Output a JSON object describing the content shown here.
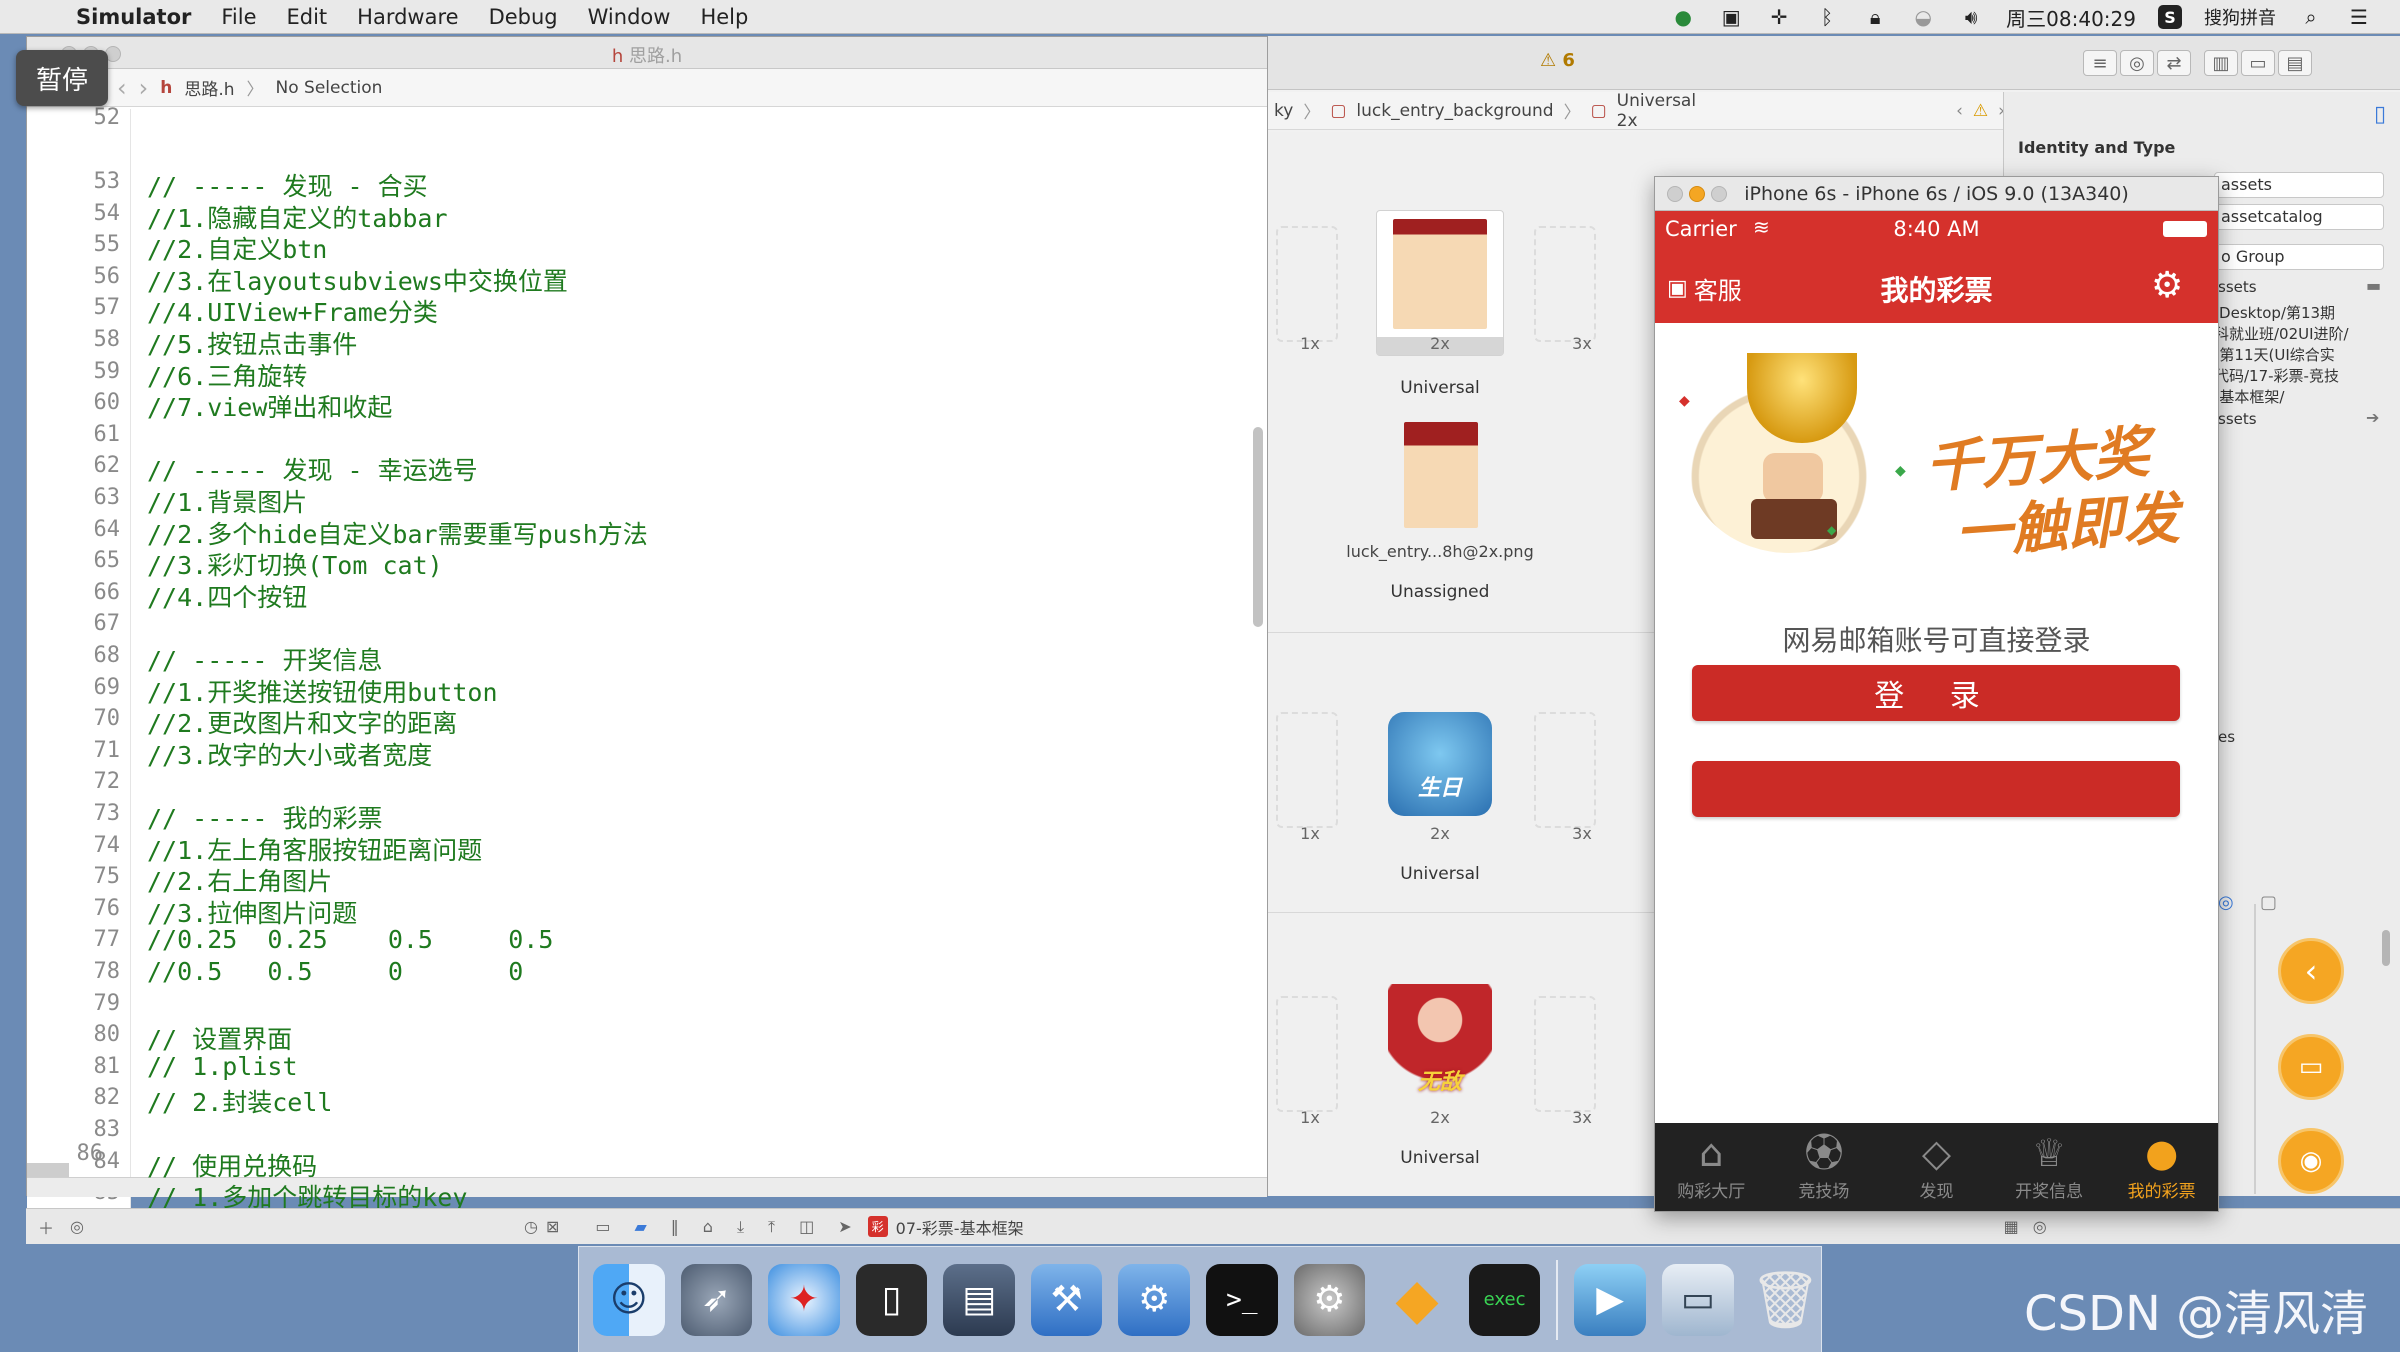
{
  "menubar": {
    "app_name": "Simulator",
    "menus": [
      "File",
      "Edit",
      "Hardware",
      "Debug",
      "Window",
      "Help"
    ],
    "clock": "周三08:40:29",
    "input_method": "搜狗拼音"
  },
  "pause_badge": "暂停",
  "editor": {
    "title": "思路.h",
    "jumpbar_file": "思路.h",
    "jumpbar_selection": "No Selection",
    "first_line_number": "52",
    "lines": [
      {
        "n": "53",
        "text": "// ----- 发现 - 合买"
      },
      {
        "n": "54",
        "text": "//1.隐藏自定义的tabbar"
      },
      {
        "n": "55",
        "text": "//2.自定义btn"
      },
      {
        "n": "56",
        "text": "//3.在layoutsubviews中交换位置"
      },
      {
        "n": "57",
        "text": "//4.UIView+Frame分类"
      },
      {
        "n": "58",
        "text": "//5.按钮点击事件"
      },
      {
        "n": "59",
        "text": "//6.三角旋转"
      },
      {
        "n": "60",
        "text": "//7.view弹出和收起"
      },
      {
        "n": "61",
        "text": ""
      },
      {
        "n": "62",
        "text": "// ----- 发现 - 幸运选号"
      },
      {
        "n": "63",
        "text": "//1.背景图片"
      },
      {
        "n": "64",
        "text": "//2.多个hide自定义bar需要重写push方法"
      },
      {
        "n": "65",
        "text": "//3.彩灯切换(Tom cat)"
      },
      {
        "n": "66",
        "text": "//4.四个按钮"
      },
      {
        "n": "67",
        "text": ""
      },
      {
        "n": "68",
        "text": "// ----- 开奖信息"
      },
      {
        "n": "69",
        "text": "//1.开奖推送按钮使用button"
      },
      {
        "n": "70",
        "text": "//2.更改图片和文字的距离"
      },
      {
        "n": "71",
        "text": "//3.改字的大小或者宽度"
      },
      {
        "n": "72",
        "text": ""
      },
      {
        "n": "73",
        "text": "// ----- 我的彩票"
      },
      {
        "n": "74",
        "text": "//1.左上角客服按钮距离问题"
      },
      {
        "n": "75",
        "text": "//2.右上角图片"
      },
      {
        "n": "76",
        "text": "//3.拉伸图片问题"
      },
      {
        "n": "77",
        "text": "//0.25  0.25    0.5     0.5"
      },
      {
        "n": "78",
        "text": "//0.5   0.5     0       0"
      },
      {
        "n": "79",
        "text": ""
      },
      {
        "n": "80",
        "text": "// 设置界面"
      },
      {
        "n": "81",
        "text": "// 1.plist"
      },
      {
        "n": "82",
        "text": "// 2.封装cell"
      },
      {
        "n": "83",
        "text": ""
      },
      {
        "n": "84",
        "text": "// 使用兑换码"
      },
      {
        "n": "85",
        "text": "// 1.多加个跳转目标的key"
      }
    ],
    "last_line_number": "86"
  },
  "xcode_right": {
    "warning_count": "6",
    "crumbs": [
      "ky",
      "luck_entry_background",
      "Universal 2x"
    ],
    "asset_groups": [
      {
        "label": "Universal",
        "slots": [
          "1x",
          "2x",
          "3x"
        ]
      },
      {
        "label": "Unassigned",
        "file": "luck_entry...8h@2x.png"
      },
      {
        "label": "Universal",
        "slots": [
          "1x",
          "2x",
          "3x"
        ]
      },
      {
        "label": "Universal",
        "slots": [
          "1x",
          "2x",
          "3x"
        ]
      }
    ],
    "birthday_badge": "生日",
    "wudi_badge": "无敌"
  },
  "inspector": {
    "title": "Identity and Type",
    "name_field": "assets",
    "type_field": "assetcatalog",
    "location_field": "o Group",
    "label_assets": "ssets",
    "path_lines": [
      "/Desktop/第13期",
      "科就业班/02UI进阶/",
      "-第11天(UI综合实",
      "代码/17-彩票-竞技",
      "-基本框架/"
    ],
    "label_assets2": "ssets",
    "label_es": "es"
  },
  "simulator": {
    "title": "iPhone 6s - iPhone 6s / iOS 9.0 (13A340)",
    "status": {
      "carrier": "Carrier",
      "time": "8:40 AM"
    },
    "nav": {
      "left": "客服",
      "title": "我的彩票"
    },
    "promo": {
      "line1": "千万大奖",
      "line2": "一触即发"
    },
    "login_hint": "网易邮箱账号可直接登录",
    "login_button": "登 录",
    "tabs": [
      {
        "label": "购彩大厅",
        "icon": "home-icon"
      },
      {
        "label": "竞技场",
        "icon": "soccer-ball-icon"
      },
      {
        "label": "发现",
        "icon": "diamond-icon"
      },
      {
        "label": "开奖信息",
        "icon": "trophy-icon"
      },
      {
        "label": "我的彩票",
        "icon": "person-icon",
        "active": true
      }
    ]
  },
  "bottom_bar": {
    "scheme_label": "07-彩票-基本框架"
  },
  "watermark": "CSDN @清风清晨",
  "colors": {
    "ios_red": "#d5312c",
    "button_red": "#cb2b26",
    "code_green": "#1f7a1f",
    "tab_active": "#f2a21d"
  }
}
